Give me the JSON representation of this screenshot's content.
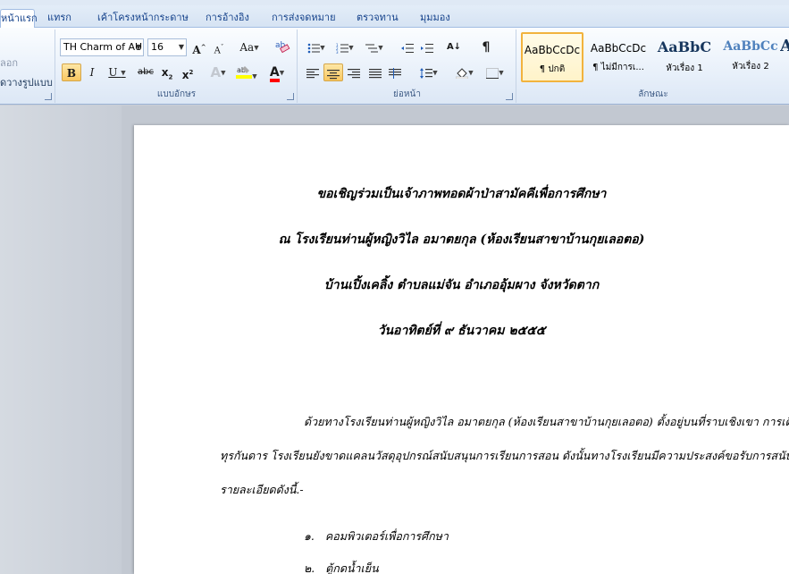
{
  "tabs": [
    {
      "label": "หน้าแรก",
      "active": true
    },
    {
      "label": "แทรก"
    },
    {
      "label": "เค้าโครงหน้ากระดาษ"
    },
    {
      "label": "การอ้างอิง"
    },
    {
      "label": "การส่งจดหมาย"
    },
    {
      "label": "ตรวจทาน"
    },
    {
      "label": "มุมมอง"
    }
  ],
  "clipboard": {
    "copy_label": "ลอก",
    "format_painter_label": "ัดวางรูปแบบ"
  },
  "font": {
    "name": "TH Charm of AU",
    "size": "16",
    "group_label": "แบบอักษร"
  },
  "paragraph": {
    "group_label": "ย่อหน้า"
  },
  "styles": {
    "group_label": "ลักษณะ",
    "items": [
      {
        "sample": "AaBbCcDc",
        "name": "¶ ปกติ",
        "color": "#000000",
        "selected": true
      },
      {
        "sample": "AaBbCcDc",
        "name": "¶ ไม่มีการเ...",
        "color": "#000000"
      },
      {
        "sample": "AaBbC",
        "name": "หัวเรื่อง 1",
        "color": "#17365d"
      },
      {
        "sample": "AaBbCc",
        "name": "หัวเรื่อง 2",
        "color": "#4f81bd"
      },
      {
        "sample": "A",
        "name": "",
        "color": "#17365d"
      }
    ]
  },
  "document": {
    "title_lines": [
      "ขอเชิญร่วมเป็นเจ้าภาพทอดผ้าป่าสามัคคีเพื่อการศึกษา",
      "ณ  โรงเรียนท่านผู้หญิงวิไล   อมาตยกุล (ห้องเรียนสาขาบ้านกุยเลอตอ)",
      "บ้านเปิ้งเคลิ้ง  ตำบลแม่จัน  อำเภออุ้มผาง  จังหวัดตาก",
      "วันอาทิตย์ที่  ๙  ธันวาคม  ๒๕๕๕"
    ],
    "body_lines": [
      "ด้วยทางโรงเรียนท่านผู้หญิงวิไล   อมาตยกุล (ห้องเรียนสาขาบ้านกุยเลอตอ)  ตั้งอยู่บนที่ราบเชิงเขา  การเดินทา-",
      "ทุรกันดาร    โรงเรียนยังขาดแคลนวัสดุอุปกรณ์สนับสนุนการเรียนการสอน   ดังนั้นทางโรงเรียนมีความประสงค์ขอรับการสนับสนุน   มี",
      "รายละเอียดดังนี้.-"
    ],
    "list_items": [
      {
        "num": "๑.",
        "text": "คอมพิวเตอร์เพื่อการศึกษา"
      },
      {
        "num": "๒.",
        "text": "ตู้กดน้ำเย็น"
      }
    ]
  },
  "colors": {
    "highlight": "#ffff00",
    "font_color": "#ff0000",
    "accent": "#f2b33d"
  }
}
